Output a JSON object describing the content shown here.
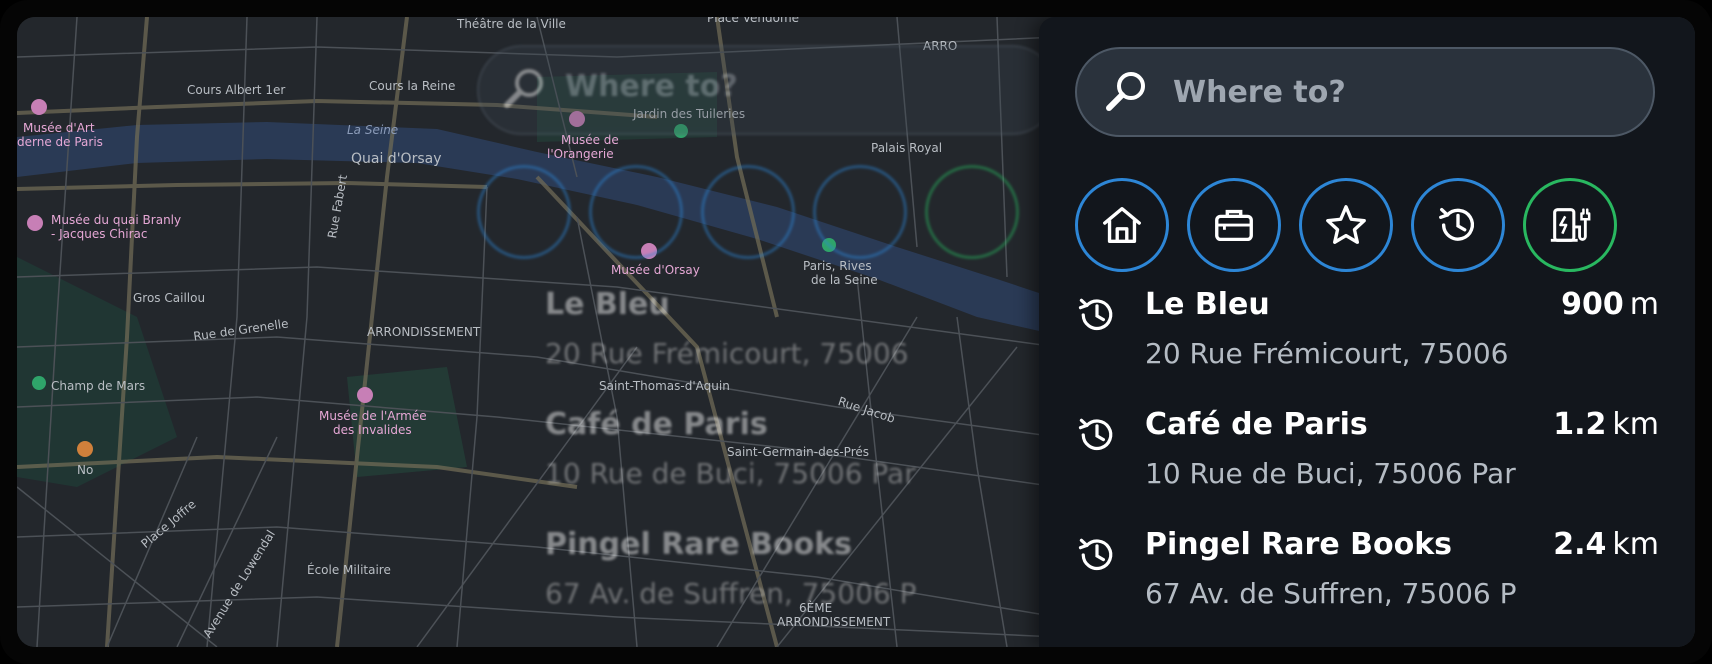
{
  "search": {
    "placeholder": "Where to?"
  },
  "quick_actions": [
    {
      "name": "home-icon"
    },
    {
      "name": "work-icon"
    },
    {
      "name": "favorites-icon"
    },
    {
      "name": "recent-icon"
    },
    {
      "name": "ev-charging-icon"
    }
  ],
  "colors": {
    "accent": "#2d86d6",
    "ev": "#29b860",
    "panel": "#12161c"
  },
  "results": [
    {
      "name": "Le Bleu",
      "address": "20 Rue Frémicourt, 75006",
      "distance_value": "900",
      "distance_unit": "m"
    },
    {
      "name": "Café de Paris",
      "address": "10 Rue de Buci, 75006 Par",
      "distance_value": "1.2",
      "distance_unit": "km"
    },
    {
      "name": "Pingel Rare Books",
      "address": "67 Av. de Suffren, 75006 P",
      "distance_value": "2.4",
      "distance_unit": "km"
    }
  ],
  "map_labels": {
    "theatre": "Théâtre de la Ville",
    "vendome": "Place Vendôme",
    "albert": "Cours Albert 1er",
    "reine": "Cours la Reine",
    "art": "Musée d'Art",
    "art2": "derne de Paris",
    "seine": "La Seine",
    "orsay_quai": "Quai d'Orsay",
    "tuileries": "Jardin des Tuileries",
    "orangerie": "Musée de",
    "orangerie2": "l'Orangerie",
    "palais": "Palais Royal",
    "branly": "Musée du quai Branly",
    "branly2": "- Jacques Chirac",
    "fabert": "Rue Fabert",
    "musee_orsay": "Musée d'Orsay",
    "rives": "Paris, Rives",
    "rives2": "de la Seine",
    "gros": "Gros Caillou",
    "grenelle": "Rue de Grenelle",
    "arrond": "ARRONDISSEMENT",
    "thomas": "Saint-Thomas-d'Aquin",
    "jacob": "Rue Jacob",
    "germain": "Saint-Germain-des-Prés",
    "champ": "Champ de Mars",
    "armee": "Musée de l'Armée",
    "armee2": "des Invalides",
    "no": "No",
    "joffre": "Place Joffre",
    "lowendal": "Avenue de Lowendal",
    "ecole": "École Militaire",
    "arr6": "6ÈME",
    "arr6b": "ARRONDISSEMENT",
    "arro_top": "ARRO"
  }
}
